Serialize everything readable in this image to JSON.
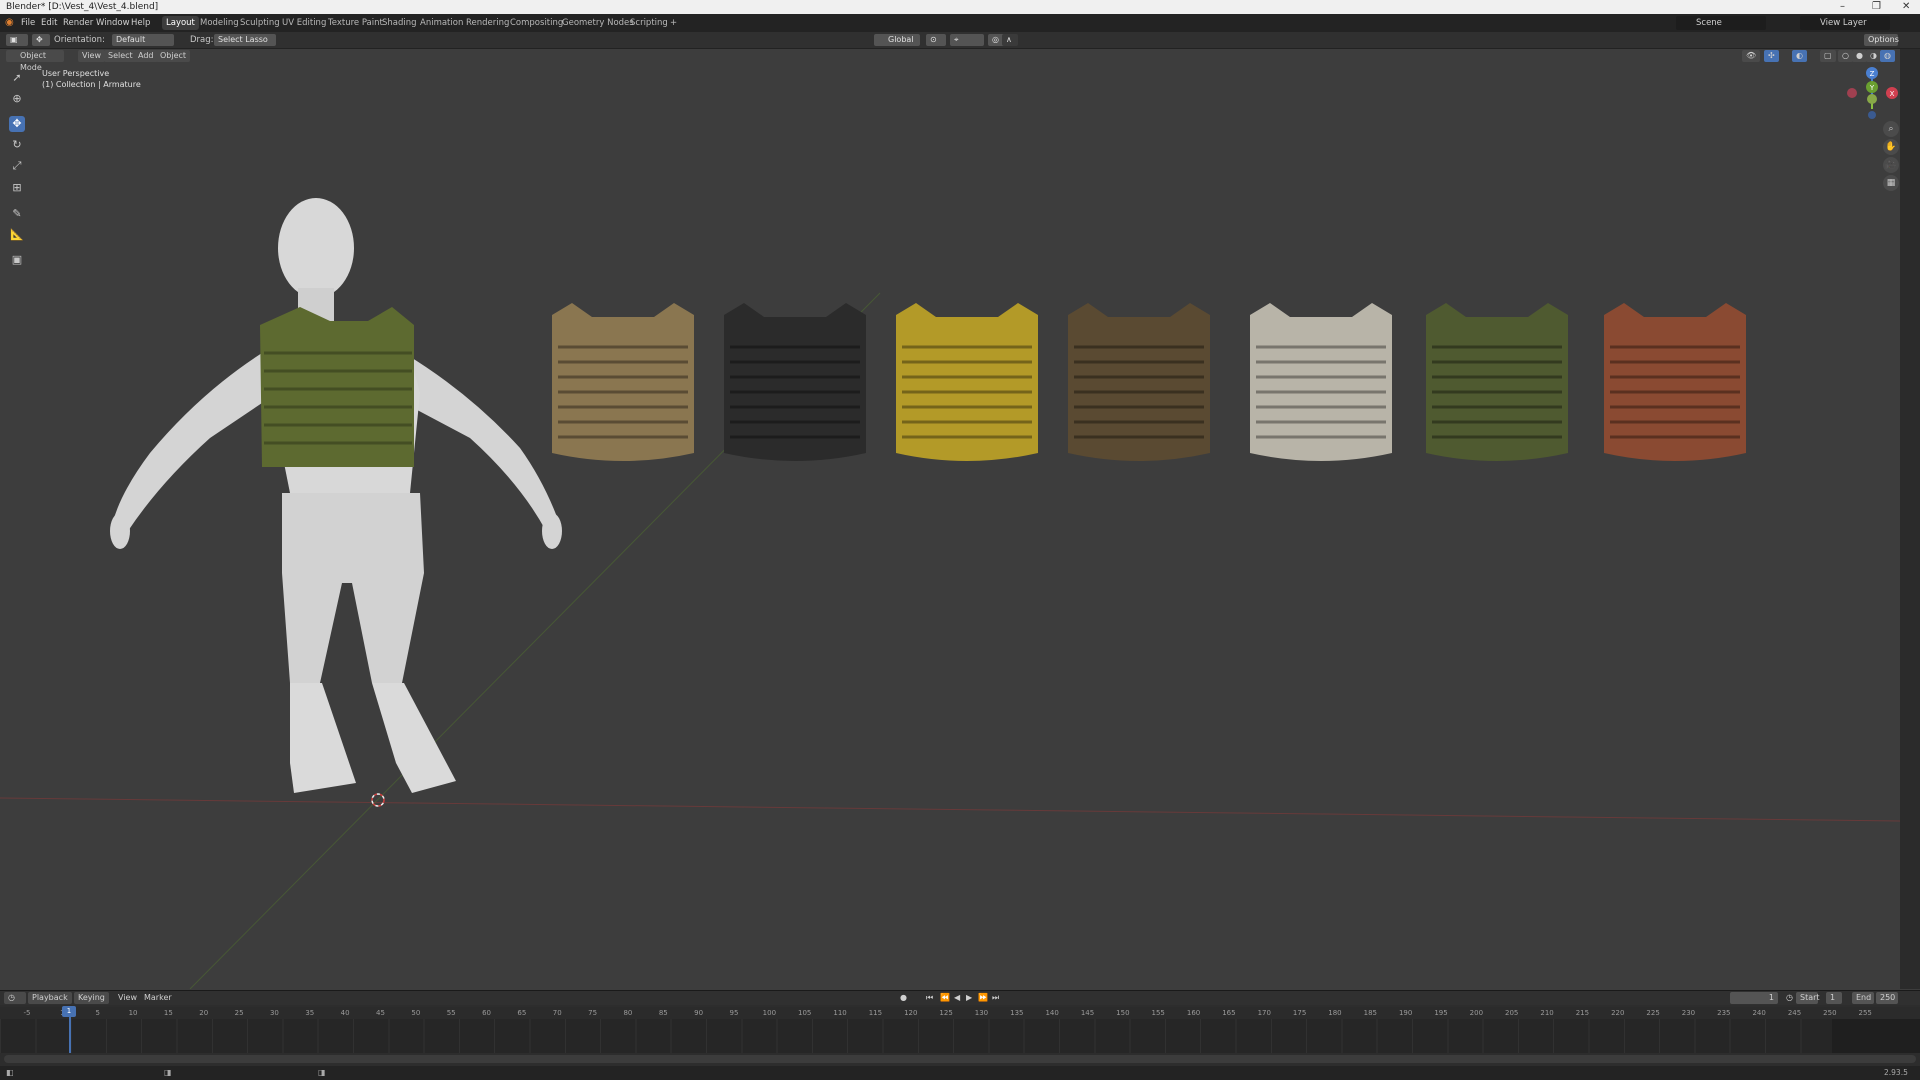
{
  "window": {
    "title": "Blender* [D:\\Vest_4\\Vest_4.blend]",
    "minimize": "–",
    "maximize": "❐",
    "close": "✕"
  },
  "menu": {
    "items": [
      "File",
      "Edit",
      "Render",
      "Window",
      "Help"
    ],
    "workspaces": [
      "Layout",
      "Modeling",
      "Sculpting",
      "UV Editing",
      "Texture Paint",
      "Shading",
      "Animation",
      "Rendering",
      "Compositing",
      "Geometry Nodes",
      "Scripting"
    ],
    "add_workspace": "+",
    "scene": "Scene",
    "view_layer": "View Layer"
  },
  "tool_settings": {
    "orientation_label": "Orientation:",
    "orientation_value": "Default",
    "drag_label": "Drag:",
    "drag_value": "Select Lasso",
    "transform_orientation": "Global",
    "options": "Options"
  },
  "viewport": {
    "mode": "Object Mode",
    "menus": [
      "View",
      "Select",
      "Add",
      "Object"
    ],
    "perspective": "User Perspective",
    "collection": "(1) Collection | Armature"
  },
  "gizmo": {
    "z": "Z",
    "y": "Y",
    "x": "X"
  },
  "scene_content": {
    "mannequin_color": "#d6d6d6",
    "vest_colors": [
      "#8a7650",
      "#2b2b2b",
      "#b39a28",
      "#5a4a32",
      "#b8b4a8",
      "#4f5a30",
      "#8a4a32"
    ],
    "worn_vest_color": "#5d6a30"
  },
  "timeline": {
    "menus": [
      "Playback",
      "Keying",
      "View",
      "Marker"
    ],
    "current_frame": "1",
    "start_label": "Start",
    "start_value": "1",
    "end_label": "End",
    "end_value": "250",
    "ruler_ticks": [
      "-5",
      "1",
      "5",
      "10",
      "15",
      "20",
      "25",
      "30",
      "35",
      "40",
      "45",
      "50",
      "55",
      "60",
      "65",
      "70",
      "75",
      "80",
      "85",
      "90",
      "95",
      "100",
      "105",
      "110",
      "115",
      "120",
      "125",
      "130",
      "135",
      "140",
      "145",
      "150",
      "155",
      "160",
      "165",
      "170",
      "175",
      "180",
      "185",
      "190",
      "195",
      "200",
      "205",
      "210",
      "215",
      "220",
      "225",
      "230",
      "235",
      "240",
      "245",
      "250",
      "255"
    ]
  },
  "status": {
    "version": "2.93.5"
  }
}
